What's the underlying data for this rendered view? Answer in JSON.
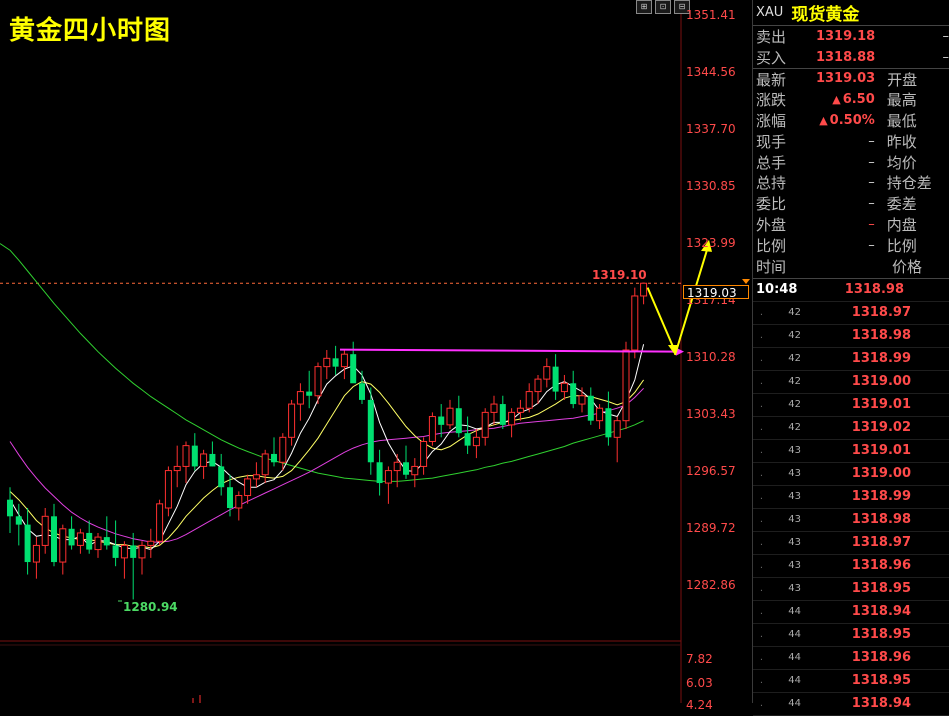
{
  "chart": {
    "title": "黄金四小时图",
    "toolbar": [
      "⊞",
      "⊡",
      "⊟"
    ],
    "price_axis": [
      "1351.41",
      "1344.56",
      "1337.70",
      "1330.85",
      "1323.99",
      "1317.14",
      "1310.28",
      "1303.43",
      "1296.57",
      "1289.72",
      "1282.86"
    ],
    "volume_axis": [
      "7.82",
      "6.03",
      "4.24"
    ],
    "current_price": "1319.03",
    "high_label": "1319.10",
    "low_label": "1280.94",
    "colors": {
      "up": "#ff3030",
      "down": "#00e070",
      "ma5": "#ffffff",
      "ma10": "#ffff66",
      "ma20": "#e040e0",
      "ma60": "#30d030",
      "resistance": "#ff30ff",
      "arrow": "#ffff00"
    }
  },
  "chart_data": {
    "type": "candlestick",
    "ylim": [
      1276,
      1352
    ],
    "candles": [
      [
        1293.0,
        1294.5,
        1289.0,
        1291.0
      ],
      [
        1291.0,
        1292.5,
        1287.5,
        1290.0
      ],
      [
        1290.0,
        1292.0,
        1284.0,
        1285.5
      ],
      [
        1285.5,
        1288.5,
        1283.5,
        1287.5
      ],
      [
        1287.5,
        1292.0,
        1286.5,
        1291.0
      ],
      [
        1291.0,
        1292.5,
        1285.0,
        1285.5
      ],
      [
        1285.5,
        1290.0,
        1284.0,
        1289.5
      ],
      [
        1289.5,
        1291.0,
        1287.0,
        1287.5
      ],
      [
        1287.5,
        1289.5,
        1286.5,
        1289.0
      ],
      [
        1289.0,
        1290.5,
        1286.5,
        1287.0
      ],
      [
        1287.0,
        1289.0,
        1286.0,
        1288.5
      ],
      [
        1288.5,
        1291.0,
        1287.0,
        1287.5
      ],
      [
        1287.5,
        1290.5,
        1285.0,
        1286.0
      ],
      [
        1286.0,
        1288.0,
        1283.5,
        1287.5
      ],
      [
        1287.5,
        1289.0,
        1281.0,
        1286.0
      ],
      [
        1286.0,
        1288.0,
        1284.0,
        1287.5
      ],
      [
        1287.5,
        1289.5,
        1286.0,
        1288.0
      ],
      [
        1288.0,
        1293.0,
        1287.5,
        1292.5
      ],
      [
        1292.0,
        1297.0,
        1291.0,
        1296.5
      ],
      [
        1296.5,
        1299.5,
        1294.5,
        1297.0
      ],
      [
        1297.0,
        1300.0,
        1295.0,
        1299.5
      ],
      [
        1299.5,
        1301.0,
        1296.5,
        1297.0
      ],
      [
        1297.0,
        1299.0,
        1295.5,
        1298.5
      ],
      [
        1298.5,
        1300.0,
        1297.0,
        1297.0
      ],
      [
        1297.0,
        1298.5,
        1293.5,
        1294.5
      ],
      [
        1294.5,
        1296.0,
        1291.0,
        1292.0
      ],
      [
        1292.0,
        1294.0,
        1290.5,
        1293.5
      ],
      [
        1293.5,
        1296.0,
        1292.5,
        1295.5
      ],
      [
        1295.5,
        1297.5,
        1294.5,
        1296.0
      ],
      [
        1296.0,
        1299.0,
        1295.0,
        1298.5
      ],
      [
        1298.5,
        1300.5,
        1297.0,
        1297.5
      ],
      [
        1297.5,
        1301.0,
        1296.5,
        1300.5
      ],
      [
        1300.5,
        1305.0,
        1299.5,
        1304.5
      ],
      [
        1304.5,
        1307.0,
        1302.5,
        1306.0
      ],
      [
        1306.0,
        1308.5,
        1304.0,
        1305.5
      ],
      [
        1305.5,
        1309.5,
        1304.5,
        1309.0
      ],
      [
        1309.0,
        1311.0,
        1307.5,
        1310.0
      ],
      [
        1310.0,
        1311.5,
        1308.0,
        1309.0
      ],
      [
        1309.0,
        1311.0,
        1307.5,
        1310.5
      ],
      [
        1310.5,
        1312.0,
        1308.5,
        1307.0
      ],
      [
        1307.0,
        1308.5,
        1304.5,
        1305.0
      ],
      [
        1305.0,
        1306.5,
        1296.0,
        1297.5
      ],
      [
        1297.5,
        1299.0,
        1293.5,
        1295.0
      ],
      [
        1295.0,
        1297.0,
        1292.5,
        1296.5
      ],
      [
        1296.5,
        1298.5,
        1294.5,
        1297.5
      ],
      [
        1297.5,
        1299.5,
        1295.5,
        1296.0
      ],
      [
        1296.0,
        1298.0,
        1294.5,
        1297.0
      ],
      [
        1297.0,
        1300.5,
        1296.0,
        1300.0
      ],
      [
        1300.0,
        1303.5,
        1299.5,
        1303.0
      ],
      [
        1303.0,
        1304.5,
        1300.5,
        1302.0
      ],
      [
        1302.0,
        1305.0,
        1301.5,
        1304.0
      ],
      [
        1304.0,
        1305.5,
        1300.5,
        1301.0
      ],
      [
        1301.0,
        1303.0,
        1298.5,
        1299.5
      ],
      [
        1299.5,
        1301.5,
        1298.0,
        1300.5
      ],
      [
        1300.5,
        1304.0,
        1299.5,
        1303.5
      ],
      [
        1303.5,
        1305.5,
        1302.0,
        1304.5
      ],
      [
        1304.5,
        1305.5,
        1301.5,
        1302.0
      ],
      [
        1302.0,
        1304.0,
        1300.5,
        1303.5
      ],
      [
        1303.5,
        1305.0,
        1302.5,
        1304.0
      ],
      [
        1304.0,
        1307.0,
        1303.5,
        1306.0
      ],
      [
        1306.0,
        1308.0,
        1304.5,
        1307.5
      ],
      [
        1307.5,
        1310.0,
        1306.5,
        1309.0
      ],
      [
        1309.0,
        1310.5,
        1305.0,
        1306.0
      ],
      [
        1306.0,
        1308.0,
        1305.0,
        1307.0
      ],
      [
        1307.0,
        1308.5,
        1304.0,
        1304.5
      ],
      [
        1304.5,
        1306.5,
        1303.5,
        1305.5
      ],
      [
        1305.5,
        1306.5,
        1302.0,
        1302.5
      ],
      [
        1302.5,
        1304.5,
        1301.5,
        1304.0
      ],
      [
        1304.0,
        1306.0,
        1299.5,
        1300.5
      ],
      [
        1300.5,
        1303.0,
        1297.5,
        1302.5
      ],
      [
        1302.5,
        1312.0,
        1301.5,
        1311.0
      ],
      [
        1311.0,
        1318.5,
        1310.0,
        1317.5
      ],
      [
        1317.5,
        1319.1,
        1316.5,
        1319.03
      ]
    ],
    "ma5": [
      1293.0,
      1291.2,
      1289.5,
      1288.6,
      1288.8,
      1288.6,
      1288.2,
      1288.2,
      1288.6,
      1287.5,
      1288.1,
      1288.0,
      1287.6,
      1287.2,
      1287.1,
      1287.3,
      1287.0,
      1288.0,
      1290.1,
      1292.2,
      1294.8,
      1296.4,
      1297.4,
      1297.6,
      1296.9,
      1295.9,
      1295.1,
      1294.5,
      1294.5,
      1295.1,
      1295.4,
      1296.6,
      1298.6,
      1301.0,
      1302.8,
      1305.0,
      1306.9,
      1307.9,
      1308.7,
      1309.1,
      1308.0,
      1305.7,
      1302.3,
      1299.8,
      1298.0,
      1296.5,
      1296.4,
      1297.4,
      1298.8,
      1299.7,
      1301.2,
      1302.0,
      1301.9,
      1301.5,
      1301.7,
      1302.3,
      1302.3,
      1302.6,
      1303.5,
      1303.9,
      1304.6,
      1306.0,
      1306.8,
      1307.2,
      1306.6,
      1306.0,
      1305.1,
      1303.7,
      1303.3,
      1303.0,
      1304.9,
      1307.4,
      1311.7
    ],
    "ma10": [
      1294.0,
      1293.0,
      1291.8,
      1290.5,
      1289.6,
      1289.0,
      1288.6,
      1288.4,
      1288.2,
      1288.2,
      1288.0,
      1287.8,
      1287.6,
      1287.6,
      1287.4,
      1287.4,
      1287.2,
      1287.5,
      1288.4,
      1289.6,
      1291.0,
      1292.1,
      1293.2,
      1294.1,
      1294.9,
      1295.4,
      1295.7,
      1295.9,
      1295.9,
      1295.7,
      1295.6,
      1295.8,
      1296.5,
      1297.7,
      1299.0,
      1300.4,
      1302.1,
      1303.8,
      1305.5,
      1306.6,
      1307.2,
      1306.9,
      1305.9,
      1304.6,
      1303.2,
      1301.8,
      1300.7,
      1299.8,
      1299.2,
      1299.0,
      1299.4,
      1300.1,
      1300.8,
      1301.3,
      1301.7,
      1302.0,
      1302.3,
      1302.5,
      1302.7,
      1302.9,
      1303.3,
      1303.9,
      1304.5,
      1305.2,
      1305.5,
      1305.5,
      1305.4,
      1305.1,
      1304.8,
      1304.4,
      1304.8,
      1305.9,
      1307.4
    ],
    "ma20": [
      1300.0,
      1298.4,
      1296.9,
      1295.6,
      1294.4,
      1293.4,
      1292.4,
      1291.5,
      1290.8,
      1290.2,
      1289.7,
      1289.3,
      1288.9,
      1288.6,
      1288.3,
      1288.1,
      1287.9,
      1287.9,
      1288.0,
      1288.3,
      1288.8,
      1289.4,
      1290.0,
      1290.6,
      1291.2,
      1291.8,
      1292.3,
      1292.8,
      1293.3,
      1293.8,
      1294.3,
      1294.8,
      1295.3,
      1295.8,
      1296.3,
      1296.9,
      1297.5,
      1298.1,
      1298.7,
      1299.2,
      1299.6,
      1299.9,
      1300.1,
      1300.2,
      1300.3,
      1300.4,
      1300.5,
      1300.6,
      1300.8,
      1301.0,
      1301.1,
      1301.2,
      1301.3,
      1301.4,
      1301.5,
      1301.6,
      1301.8,
      1302.0,
      1302.2,
      1302.3,
      1302.4,
      1302.5,
      1302.6,
      1302.7,
      1302.8,
      1303.0,
      1303.2,
      1303.4,
      1303.7,
      1304.0,
      1304.4,
      1305.3,
      1306.4
    ],
    "ma60": [
      1323.0,
      1321.8,
      1320.5,
      1319.2,
      1317.9,
      1316.6,
      1315.4,
      1314.2,
      1313.0,
      1311.9,
      1310.8,
      1309.8,
      1308.8,
      1307.9,
      1307.0,
      1306.2,
      1305.4,
      1304.7,
      1304.0,
      1303.3,
      1302.6,
      1302.0,
      1301.4,
      1300.8,
      1300.2,
      1299.7,
      1299.2,
      1298.8,
      1298.4,
      1298.0,
      1297.7,
      1297.4,
      1297.1,
      1296.8,
      1296.5,
      1296.2,
      1296.0,
      1295.8,
      1295.6,
      1295.5,
      1295.4,
      1295.3,
      1295.2,
      1295.2,
      1295.2,
      1295.3,
      1295.4,
      1295.5,
      1295.6,
      1295.8,
      1296.0,
      1296.2,
      1296.4,
      1296.6,
      1296.9,
      1297.1,
      1297.4,
      1297.6,
      1297.9,
      1298.2,
      1298.5,
      1298.8,
      1299.1,
      1299.4,
      1299.8,
      1300.1,
      1300.4,
      1300.7,
      1301.0,
      1301.3,
      1301.6,
      1302.0,
      1302.5
    ],
    "resistance": 1310.8,
    "projection": {
      "from": 1318.5,
      "to": 1310.4,
      "then": 1324.0
    }
  },
  "panel": {
    "symbol": "XAU",
    "name": "现货黄金",
    "quote_rows": [
      {
        "k1": "卖出",
        "v1": "1319.18",
        "k2": "",
        "v2": "–"
      },
      {
        "k1": "买入",
        "v1": "1318.88",
        "k2": "",
        "v2": "–"
      },
      {
        "k1": "最新",
        "v1": "1319.03",
        "k2": "开盘",
        "v2": ""
      },
      {
        "k1": "涨跌",
        "v1": "6.50",
        "k2": "最高",
        "v2": "",
        "arrow": "▲"
      },
      {
        "k1": "涨幅",
        "v1": "0.50%",
        "k2": "最低",
        "v2": "",
        "arrow": "▲"
      },
      {
        "k1": "现手",
        "v1": "–",
        "k2": "昨收",
        "v2": ""
      },
      {
        "k1": "总手",
        "v1": "–",
        "k2": "均价",
        "v2": ""
      },
      {
        "k1": "总持",
        "v1": "–",
        "k2": "持仓差",
        "v2": ""
      },
      {
        "k1": "委比",
        "v1": "–",
        "k2": "委差",
        "v2": ""
      },
      {
        "k1": "外盘",
        "v1": "–",
        "k2": "内盘",
        "v2": ""
      },
      {
        "k1": "比例",
        "v1": "–",
        "k2": "比例",
        "v2": ""
      }
    ],
    "ticks_header": {
      "time": "时间",
      "price": "价格"
    },
    "ticks": [
      {
        "time": "10:48",
        "price": "1318.98"
      },
      {
        "time": "42",
        "price": "1318.97"
      },
      {
        "time": "42",
        "price": "1318.98"
      },
      {
        "time": "42",
        "price": "1318.99"
      },
      {
        "time": "42",
        "price": "1319.00"
      },
      {
        "time": "42",
        "price": "1319.01"
      },
      {
        "time": "42",
        "price": "1319.02"
      },
      {
        "time": "43",
        "price": "1319.01"
      },
      {
        "time": "43",
        "price": "1319.00"
      },
      {
        "time": "43",
        "price": "1318.99"
      },
      {
        "time": "43",
        "price": "1318.98"
      },
      {
        "time": "43",
        "price": "1318.97"
      },
      {
        "time": "43",
        "price": "1318.96"
      },
      {
        "time": "43",
        "price": "1318.95"
      },
      {
        "time": "44",
        "price": "1318.94"
      },
      {
        "time": "44",
        "price": "1318.95"
      },
      {
        "time": "44",
        "price": "1318.96"
      },
      {
        "time": "44",
        "price": "1318.95"
      },
      {
        "time": "44",
        "price": "1318.94"
      }
    ]
  }
}
